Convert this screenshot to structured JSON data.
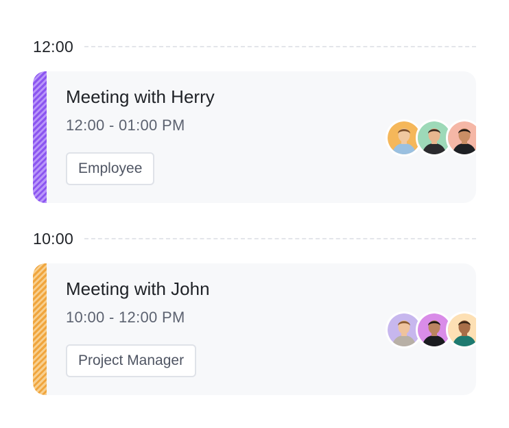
{
  "events": [
    {
      "time_marker": "12:00",
      "title": "Meeting with Herry",
      "time_range": "12:00 - 01:00 PM",
      "tag": "Employee",
      "accent": "#8b55f0",
      "attendees": [
        {
          "icon": "avatar-person",
          "bg": "#f5b75a",
          "skin": "#f0c8a0",
          "hair": "#7a4e2b",
          "shirt": "#9ac0e0"
        },
        {
          "icon": "avatar-person",
          "bg": "#9dd9b8",
          "skin": "#e8b78f",
          "hair": "#3a2a20",
          "shirt": "#2b2b2e"
        },
        {
          "icon": "avatar-person",
          "bg": "#f5b7a6",
          "skin": "#c98e65",
          "hair": "#1f1814",
          "shirt": "#1e2024"
        }
      ]
    },
    {
      "time_marker": "10:00",
      "title": "Meeting with John",
      "time_range": "10:00 - 12:00 PM",
      "tag": "Project Manager",
      "accent": "#f0a53d",
      "attendees": [
        {
          "icon": "avatar-person",
          "bg": "#c7b7ee",
          "skin": "#efc39d",
          "hair": "#8a5a32",
          "shirt": "#b8b0a6"
        },
        {
          "icon": "avatar-person",
          "bg": "#d98ce8",
          "skin": "#bb8460",
          "hair": "#1d1612",
          "shirt": "#1b1c20"
        },
        {
          "icon": "avatar-person",
          "bg": "#fde0b4",
          "skin": "#a86e48",
          "hair": "#3a2616",
          "shirt": "#1e7a70"
        }
      ]
    }
  ]
}
